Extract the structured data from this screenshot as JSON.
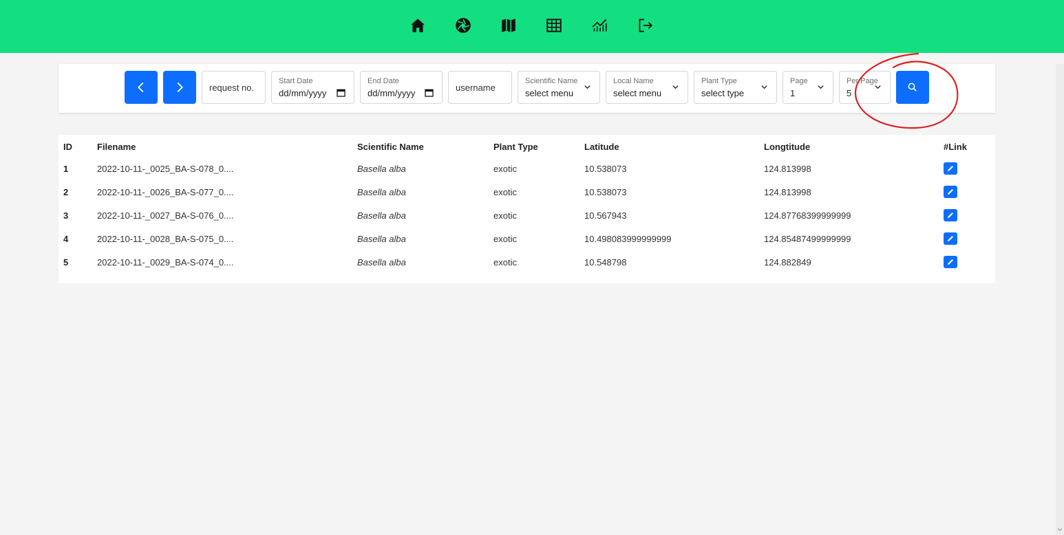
{
  "nav": {
    "icons": [
      "home-icon",
      "aperture-icon",
      "map-icon",
      "table-icon",
      "chart-icon",
      "logout-icon"
    ]
  },
  "filters": {
    "request_placeholder": "request no.",
    "start_date": {
      "label": "Start Date",
      "value": "dd/mm/yyyy"
    },
    "end_date": {
      "label": "End Date",
      "value": "dd/mm/yyyy"
    },
    "username_placeholder": "username",
    "scientific_name": {
      "label": "Scientific Name",
      "value": "select menu"
    },
    "local_name": {
      "label": "Local Name",
      "value": "select menu"
    },
    "plant_type": {
      "label": "Plant Type",
      "value": "select type"
    },
    "page": {
      "label": "Page",
      "value": "1"
    },
    "per_page": {
      "label": "Per Page",
      "value": "5"
    }
  },
  "table": {
    "headers": [
      "ID",
      "Filename",
      "Scientific Name",
      "Plant Type",
      "Latitude",
      "Longtitude",
      "#Link"
    ],
    "rows": [
      {
        "id": "1",
        "filename": "2022-10-11-_0025_BA-S-078_0....",
        "scientific_name": "Basella alba",
        "plant_type": "exotic",
        "latitude": "10.538073",
        "longitude": "124.813998"
      },
      {
        "id": "2",
        "filename": "2022-10-11-_0026_BA-S-077_0....",
        "scientific_name": "Basella alba",
        "plant_type": "exotic",
        "latitude": "10.538073",
        "longitude": "124.813998"
      },
      {
        "id": "3",
        "filename": "2022-10-11-_0027_BA-S-076_0....",
        "scientific_name": "Basella alba",
        "plant_type": "exotic",
        "latitude": "10.567943",
        "longitude": "124.87768399999999"
      },
      {
        "id": "4",
        "filename": "2022-10-11-_0028_BA-S-075_0....",
        "scientific_name": "Basella alba",
        "plant_type": "exotic",
        "latitude": "10.498083999999999",
        "longitude": "124.85487499999999"
      },
      {
        "id": "5",
        "filename": "2022-10-11-_0029_BA-S-074_0....",
        "scientific_name": "Basella alba",
        "plant_type": "exotic",
        "latitude": "10.548798",
        "longitude": "124.882849"
      }
    ]
  },
  "colors": {
    "topbar": "#14df80",
    "primary_button": "#0d6efd",
    "annotation": "#e02020"
  }
}
